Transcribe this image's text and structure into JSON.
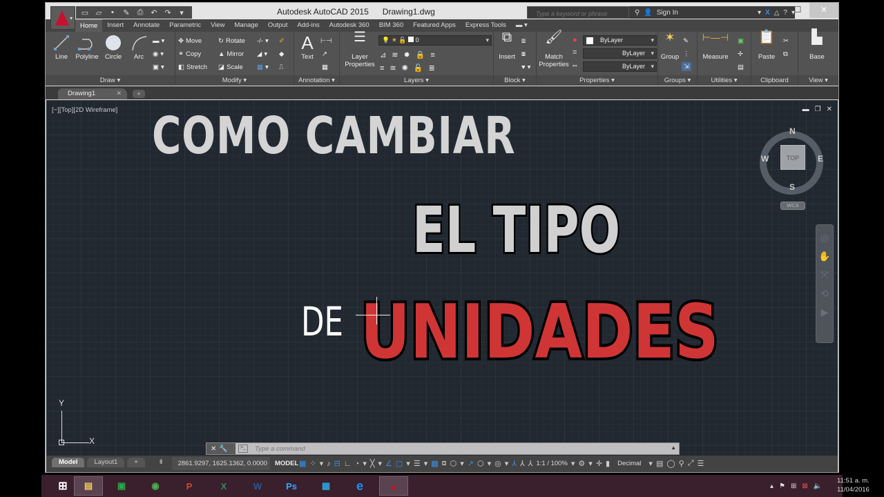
{
  "window": {
    "app_name": "Autodesk AutoCAD 2015",
    "document_name": "Drawing1.dwg"
  },
  "quick_access": [
    "new-icon",
    "open-icon",
    "save-icon",
    "saveas-icon",
    "plot-icon",
    "undo-icon",
    "redo-icon",
    "customize-icon"
  ],
  "search": {
    "placeholder": "Type a keyword or phrase"
  },
  "infocenter": {
    "signin_label": "Sign In"
  },
  "ribbon_tabs": [
    "Home",
    "Insert",
    "Annotate",
    "Parametric",
    "View",
    "Manage",
    "Output",
    "Add-ins",
    "Autodesk 360",
    "BIM 360",
    "Featured Apps",
    "Express Tools"
  ],
  "ribbon": {
    "draw": {
      "title": "Draw",
      "line": "Line",
      "polyline": "Polyline",
      "circle": "Circle",
      "arc": "Arc"
    },
    "modify": {
      "title": "Modify",
      "move": "Move",
      "rotate": "Rotate",
      "copy": "Copy",
      "mirror": "Mirror",
      "stretch": "Stretch",
      "scale": "Scale"
    },
    "annotation": {
      "title": "Annotation",
      "text": "Text"
    },
    "layers": {
      "title": "Layers",
      "layer_properties_1": "Layer",
      "layer_properties_2": "Properties",
      "current_layer": "0"
    },
    "block": {
      "title": "Block",
      "insert": "Insert"
    },
    "properties": {
      "title": "Properties",
      "match_1": "Match",
      "match_2": "Properties",
      "color": "ByLayer",
      "linetype": "ByLayer",
      "lineweight": "ByLayer"
    },
    "groups": {
      "title": "Groups",
      "group": "Group"
    },
    "utilities": {
      "title": "Utilities",
      "measure": "Measure"
    },
    "clipboard": {
      "title": "Clipboard",
      "paste": "Paste"
    },
    "view": {
      "title": "View",
      "base": "Base"
    }
  },
  "doc_tab": {
    "name": "Drawing1"
  },
  "viewport": {
    "label": "[−][Top][2D Wireframe]",
    "overlay_text": {
      "line1": "COMO CAMBIAR",
      "line2": "EL TIPO",
      "line3a": "DE",
      "line3b": "UNIDADES"
    },
    "viewcube": {
      "face": "TOP",
      "n": "N",
      "s": "S",
      "e": "E",
      "w": "W",
      "ucs": "WCS"
    },
    "ucs_icon": {
      "x": "X",
      "y": "Y"
    }
  },
  "command_line": {
    "placeholder": "Type a command"
  },
  "status_bar": {
    "layout_tabs": [
      "Model",
      "Layout1"
    ],
    "coordinates": "2861.9297, 1625.1362, 0.0000",
    "space": "MODEL",
    "annotation_scale": "1:1 / 100%",
    "units": "Decimal"
  },
  "taskbar": {
    "apps": [
      "start",
      "file-explorer",
      "store",
      "chrome",
      "powerpoint",
      "excel",
      "word",
      "photoshop",
      "movies",
      "internet-explorer",
      "autocad"
    ],
    "time": "11:51 a. m.",
    "date": "11/04/2016"
  }
}
